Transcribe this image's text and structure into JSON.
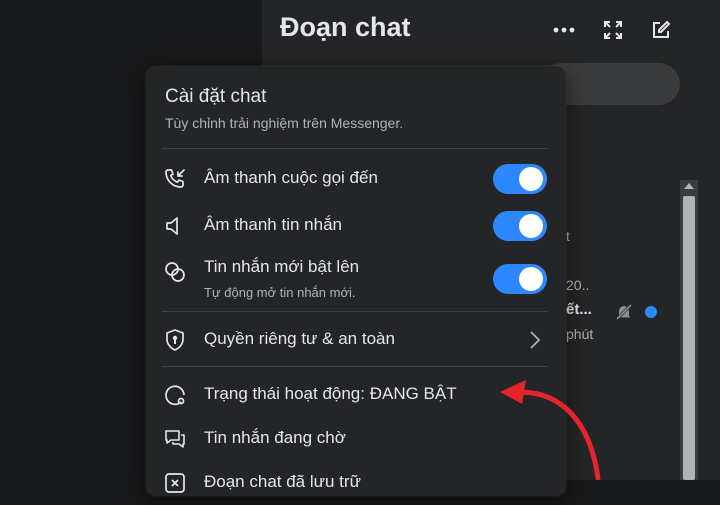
{
  "background": {
    "title": "Đoạn chat",
    "icons": [
      "more-dots-icon",
      "expand-icon",
      "compose-icon"
    ],
    "fragments": {
      "letter_t": "t",
      "year_fragment": "20..",
      "name_fragment": "ết...",
      "time_fragment": "phút"
    }
  },
  "menu": {
    "title": "Cài đặt chat",
    "subtitle": "Tùy chỉnh trải nghiệm trên Messenger.",
    "toggles": [
      {
        "icon": "incoming-call-icon",
        "label": "Âm thanh cuộc gọi đến",
        "on": true
      },
      {
        "icon": "speaker-icon",
        "label": "Âm thanh tin nhắn",
        "on": true
      },
      {
        "icon": "chat-bubbles-icon",
        "label": "Tin nhắn mới bật lên",
        "sublabel": "Tự động mở tin nhắn mới.",
        "on": true
      }
    ],
    "privacy_label": "Quyền riêng tư & an toàn",
    "active_status_label": "Trạng thái hoạt động: ĐANG BẬT",
    "pending_label": "Tin nhắn đang chờ",
    "archived_label": "Đoạn chat đã lưu trữ"
  },
  "colors": {
    "accent": "#2d88ff",
    "annotation_arrow": "#e4262c",
    "menu_bg": "#242526",
    "page_bg": "#18191a"
  }
}
